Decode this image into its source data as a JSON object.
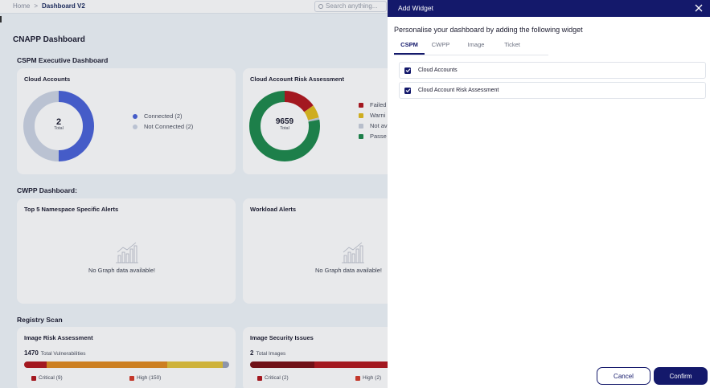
{
  "breadcrumb": {
    "home": "Home",
    "separator": ">",
    "current": "Dashboard V2"
  },
  "search": {
    "placeholder": "Search anything..."
  },
  "page_title": "CNAPP Dashboard",
  "sections": {
    "cspm": "CSPM Executive Dashboard",
    "cwpp": "CWPP Dashboard:",
    "registry": "Registry Scan"
  },
  "cards": {
    "cloud_accounts": {
      "title": "Cloud Accounts",
      "total_value": "2",
      "total_label": "Total",
      "legend": [
        "Connected (2)",
        "Not Connected (2)"
      ],
      "colors": [
        "#4a63d9",
        "#ccd4e4"
      ],
      "fractions": [
        0.5,
        0.5
      ]
    },
    "risk_assessment": {
      "title": "Cloud Account Risk Assessment",
      "total_value": "9659",
      "total_label": "Total",
      "legend": [
        "Failed",
        "Warni",
        "Not av",
        "Passe"
      ],
      "colors": [
        "#b3171d",
        "#e3bd1d",
        "#c9d0dc",
        "#1e8a4c"
      ],
      "fractions": [
        0.15,
        0.06,
        0.01,
        0.78
      ]
    },
    "namespace_alerts": {
      "title": "Top 5 Namespace Specific Alerts",
      "empty_text": "No Graph data available!"
    },
    "workload_alerts": {
      "title": "Workload Alerts",
      "empty_text": "No Graph data available!"
    },
    "image_risk": {
      "title": "Image Risk Assessment",
      "count": "1470",
      "count_label": "Total Vulnerabilities",
      "legend": [
        "Critical (9)",
        "High (150)"
      ]
    },
    "image_security": {
      "title": "Image Security Issues",
      "count": "2",
      "count_label": "Total Images",
      "legend": [
        "Critical (2)",
        "High (2)"
      ]
    }
  },
  "panel": {
    "title": "Add Widget",
    "subtitle": "Personalise your dashboard by adding the following widget",
    "tabs": [
      "CSPM",
      "CWPP",
      "Image",
      "Ticket"
    ],
    "active_tab": "CSPM",
    "items": [
      {
        "label": "Cloud Accounts",
        "checked": true
      },
      {
        "label": "Cloud Account Risk Assessment",
        "checked": true
      }
    ],
    "cancel_label": "Cancel",
    "confirm_label": "Confirm"
  }
}
